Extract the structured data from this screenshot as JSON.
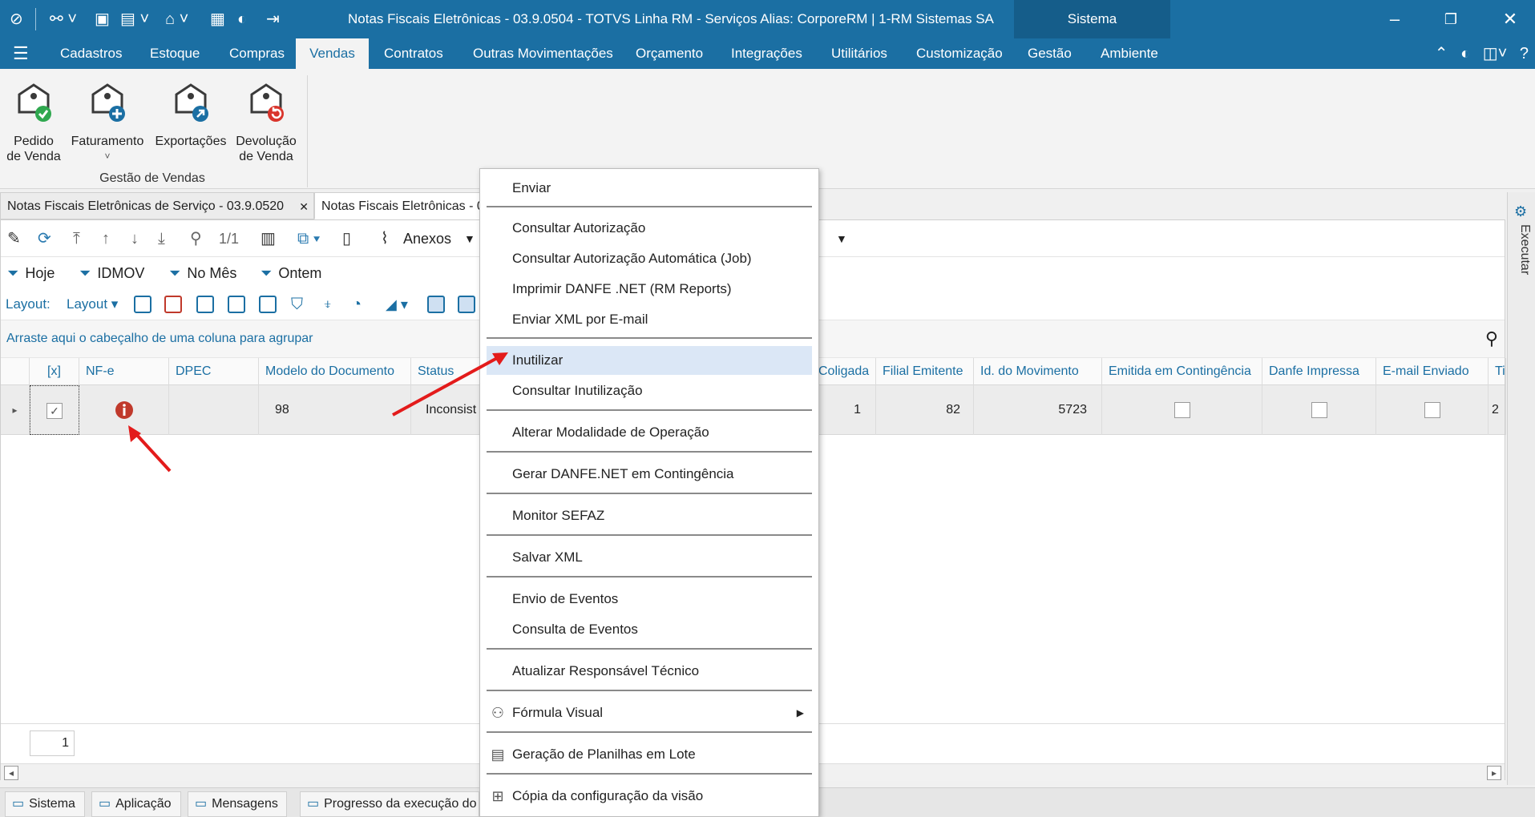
{
  "window": {
    "title": "Notas Fiscais Eletrônicas - 03.9.0504 - TOTVS Linha RM - Serviços  Alias: CorporeRM | 1-RM Sistemas SA",
    "sistema_label": "Sistema",
    "minimize": "–",
    "restore": "❐",
    "close": "✕"
  },
  "menu": {
    "items": [
      "Cadastros",
      "Estoque",
      "Compras",
      "Vendas",
      "Contratos",
      "Outras Movimentações",
      "Orçamento",
      "Integrações",
      "Utilitários",
      "Customização",
      "Gestão",
      "Ambiente"
    ],
    "active": "Vendas"
  },
  "ribbon": {
    "buttons": [
      {
        "label": "Pedido\nde Venda",
        "icon": "sale-order-icon"
      },
      {
        "label": "Faturamento",
        "icon": "billing-icon"
      },
      {
        "label": "Exportações",
        "icon": "export-icon"
      },
      {
        "label": "Devolução\nde Venda",
        "icon": "sale-return-icon"
      }
    ],
    "group_label": "Gestão de Vendas"
  },
  "doc_tabs": [
    {
      "label": "Notas Fiscais Eletrônicas de Serviço - 03.9.0520",
      "close": "✕"
    },
    {
      "label": "Notas Fiscais Eletrônicas - 0"
    }
  ],
  "toolbar": {
    "page_indicator": "1/1",
    "anexos_label": "Anexos"
  },
  "filters": [
    "Hoje",
    "IDMOV",
    "No Mês",
    "Ontem"
  ],
  "layoutbar": {
    "layout_label": "Layout:",
    "layout_dropdown": "Layout"
  },
  "group_hint": "Arraste aqui o cabeçalho de uma coluna para agrupar",
  "grid": {
    "columns": [
      "[x]",
      "NF-e",
      "DPEC",
      "Modelo do Documento",
      "Status",
      "Coligada",
      "Filial Emitente",
      "Id. do Movimento",
      "Emitida em Contingência",
      "Danfe Impressa",
      "E-mail Enviado",
      "Ti"
    ],
    "row": {
      "modelo": "98",
      "status": "Inconsist",
      "coligada": "1",
      "filial": "82",
      "id_mov": "5723",
      "tipo": "2"
    }
  },
  "pager": {
    "page": "1"
  },
  "side": {
    "executar": "Executar"
  },
  "status_tabs": [
    "Sistema",
    "Aplicação",
    "Mensagens",
    "Progresso da execução do"
  ],
  "context_menu": {
    "groups": [
      [
        "Enviar"
      ],
      [
        "Consultar Autorização",
        "Consultar Autorização Automática (Job)",
        "Imprimir DANFE .NET (RM Reports)",
        "Enviar XML por E-mail"
      ],
      [
        "Inutilizar",
        "Consultar Inutilização"
      ],
      [
        "Alterar Modalidade de Operação"
      ],
      [
        "Gerar DANFE.NET em Contingência"
      ],
      [
        "Monitor SEFAZ"
      ],
      [
        "Salvar XML"
      ],
      [
        "Envio de Eventos",
        "Consulta de Eventos"
      ],
      [
        "Atualizar Responsável Técnico"
      ],
      [
        "Fórmula Visual"
      ],
      [
        "Geração de Planilhas em Lote"
      ],
      [
        "Cópia da configuração da visão"
      ]
    ],
    "highlighted": "Inutilizar"
  },
  "colors": {
    "brand_blue": "#1b6fa3",
    "annotation_red": "#e31b1b",
    "highlight": "#dbe7f6"
  }
}
